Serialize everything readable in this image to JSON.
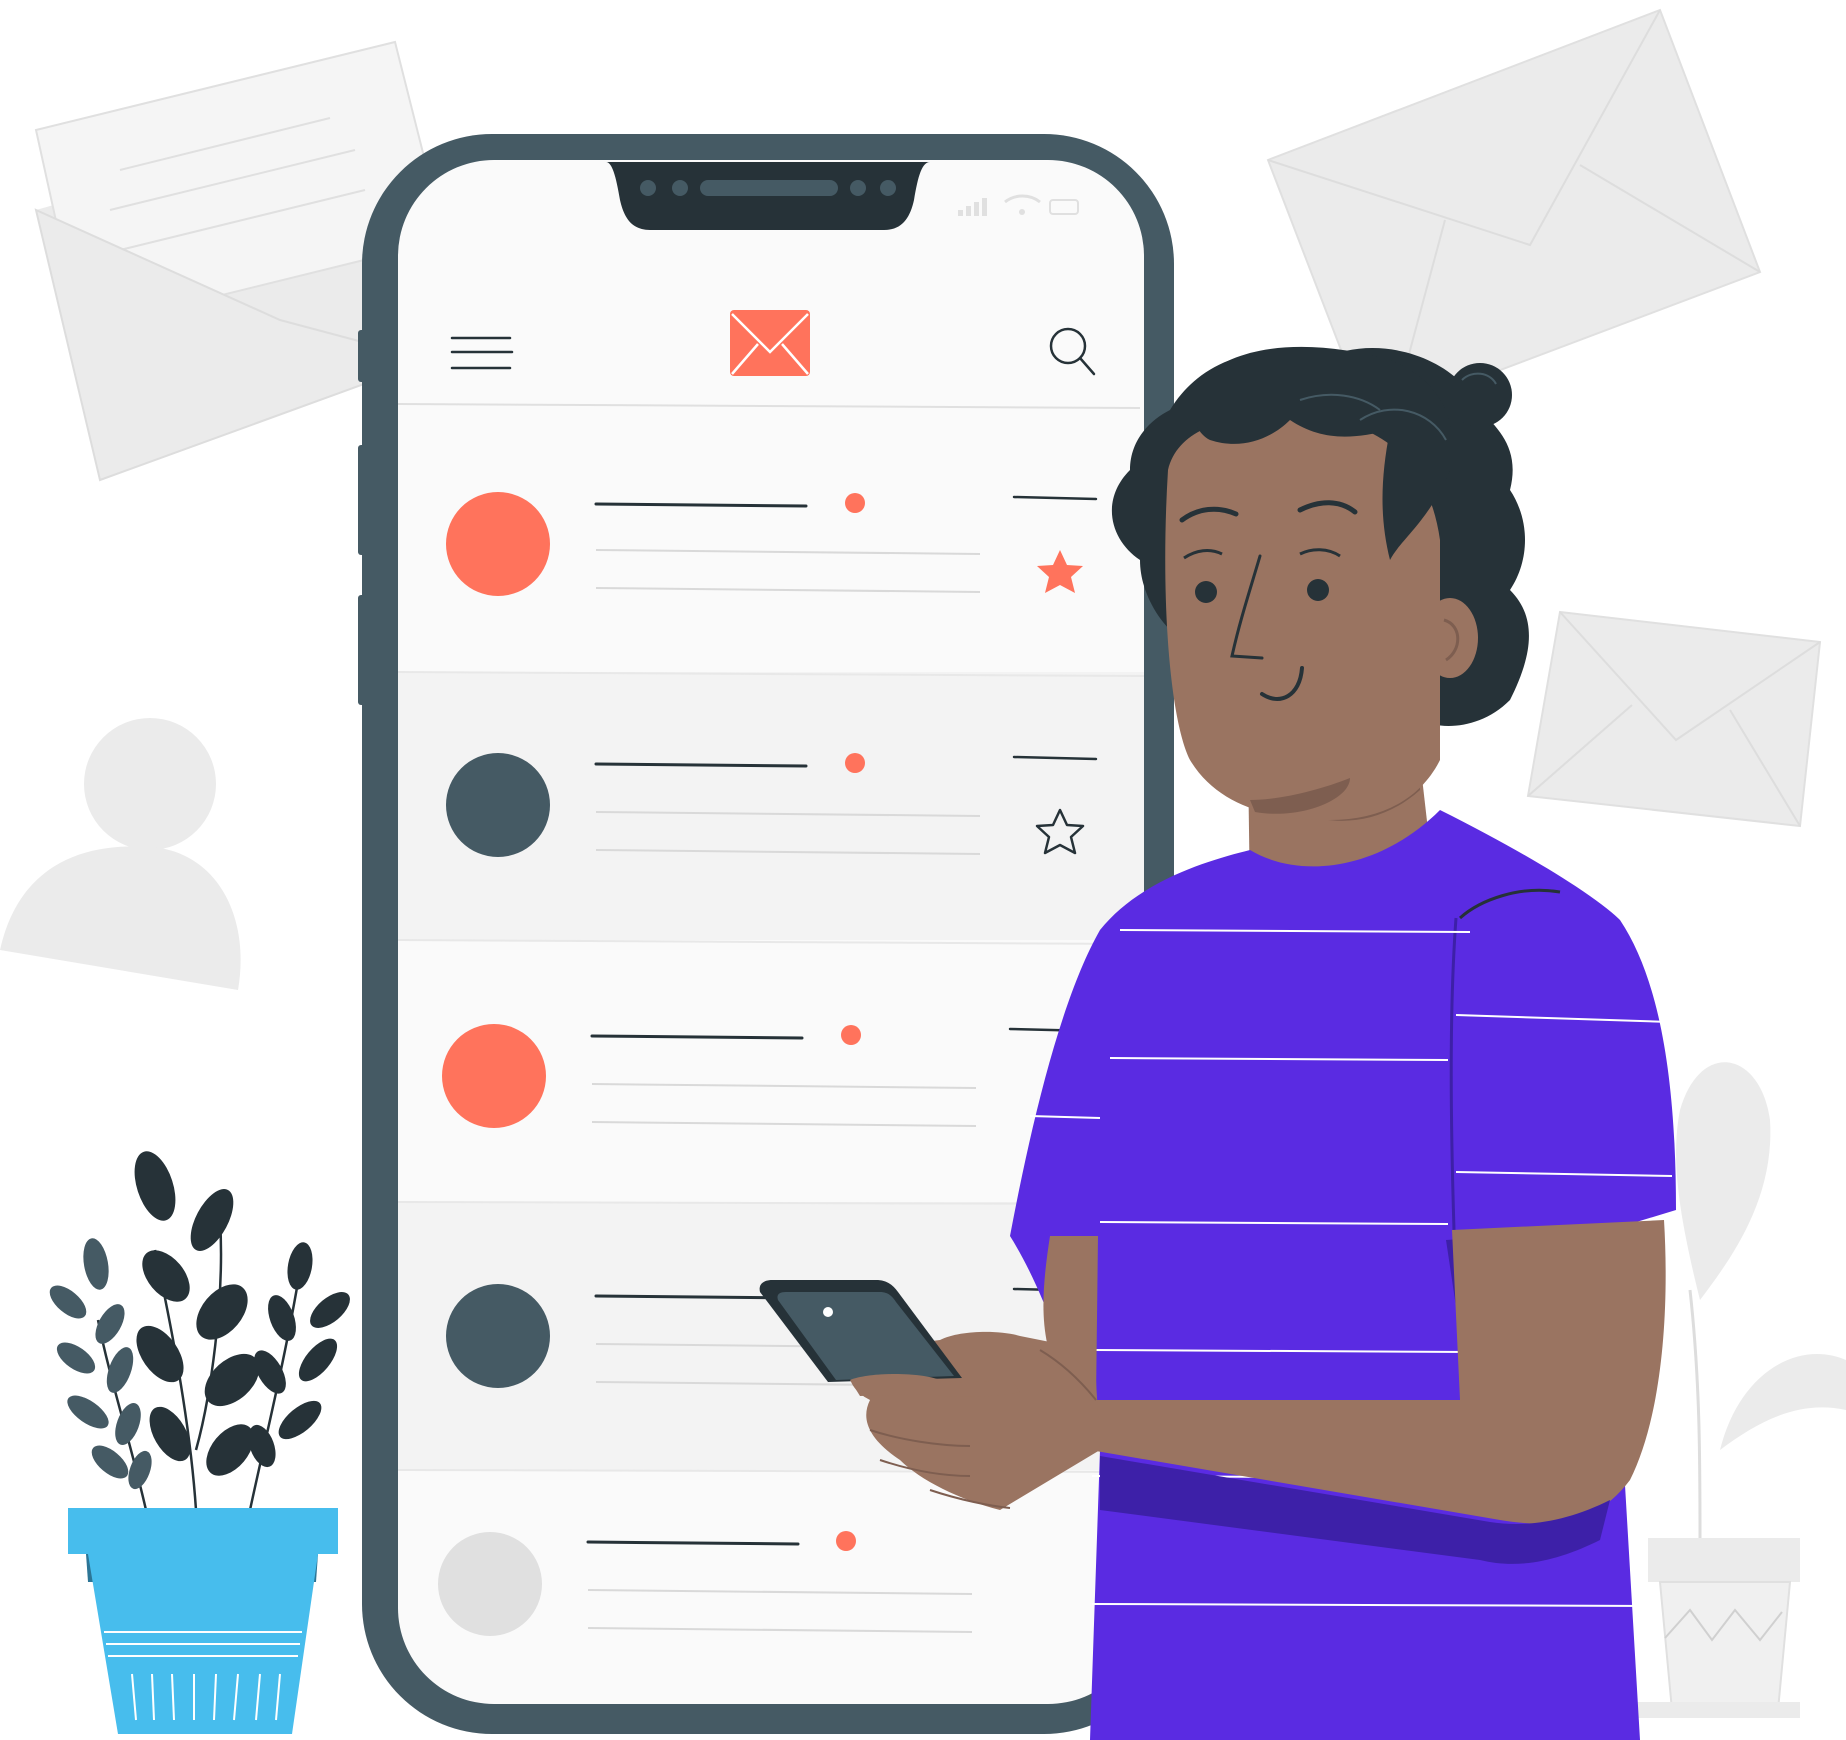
{
  "scene": {
    "subject": "email-inbox-illustration"
  },
  "colors": {
    "accent": "#FF735C",
    "phone_frame": "#455A64",
    "phone_notch": "#263238",
    "screen_bg": "#FAFAFA",
    "row_alt_bg": "#F3F3F3",
    "unread_dot": "#FF735C",
    "avatar_grey": "#455A64",
    "avatar_empty": "#E0E0E0",
    "shirt": "#5A2BE2",
    "shirt_shadow": "#3D20A8",
    "skin": "#9A7461",
    "skin_shadow": "#7E5E50",
    "hair": "#263238",
    "pot": "#47BDED",
    "pot_rim": "#2C7596",
    "leaves": "#263238",
    "background_shapes": "#EBEBEB"
  },
  "icons": {
    "menu": "hamburger-menu-icon",
    "mail": "envelope-icon",
    "search": "magnifier-icon",
    "star_filled": "star-filled-icon",
    "star_outline": "star-outline-icon"
  },
  "inbox": {
    "rows": [
      {
        "avatar": "accent",
        "starred": true,
        "unread": true
      },
      {
        "avatar": "grey",
        "starred": false,
        "unread": true
      },
      {
        "avatar": "accent",
        "starred": null,
        "unread": true
      },
      {
        "avatar": "grey",
        "starred": null,
        "unread": false
      },
      {
        "avatar": "empty",
        "starred": null,
        "unread": true
      }
    ]
  }
}
